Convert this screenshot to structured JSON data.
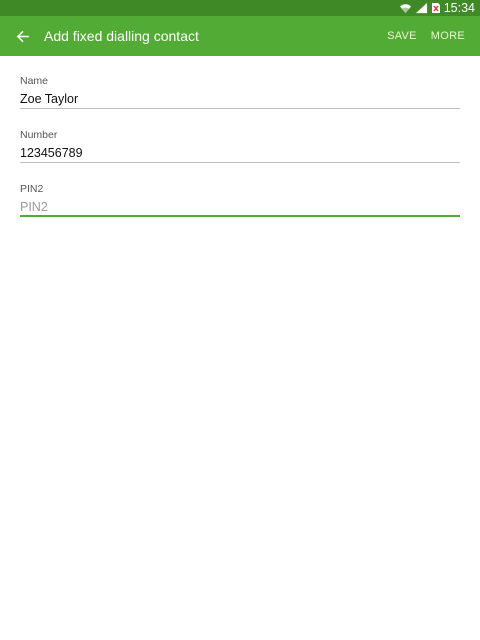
{
  "status_bar": {
    "time": "15:34",
    "icons": [
      "wifi-icon",
      "signal-icon",
      "no-sim-icon"
    ]
  },
  "app_bar": {
    "title": "Add fixed dialling contact",
    "actions": {
      "save": "SAVE",
      "more": "MORE"
    }
  },
  "form": {
    "name": {
      "label": "Name",
      "value": "Zoe Taylor",
      "placeholder": ""
    },
    "number": {
      "label": "Number",
      "value": "123456789",
      "placeholder": ""
    },
    "pin2": {
      "label": "PIN2",
      "value": "",
      "placeholder": "PIN2"
    }
  },
  "colors": {
    "status_bar": "#3f8a26",
    "app_bar": "#52ab35",
    "accent": "#52ab35"
  }
}
